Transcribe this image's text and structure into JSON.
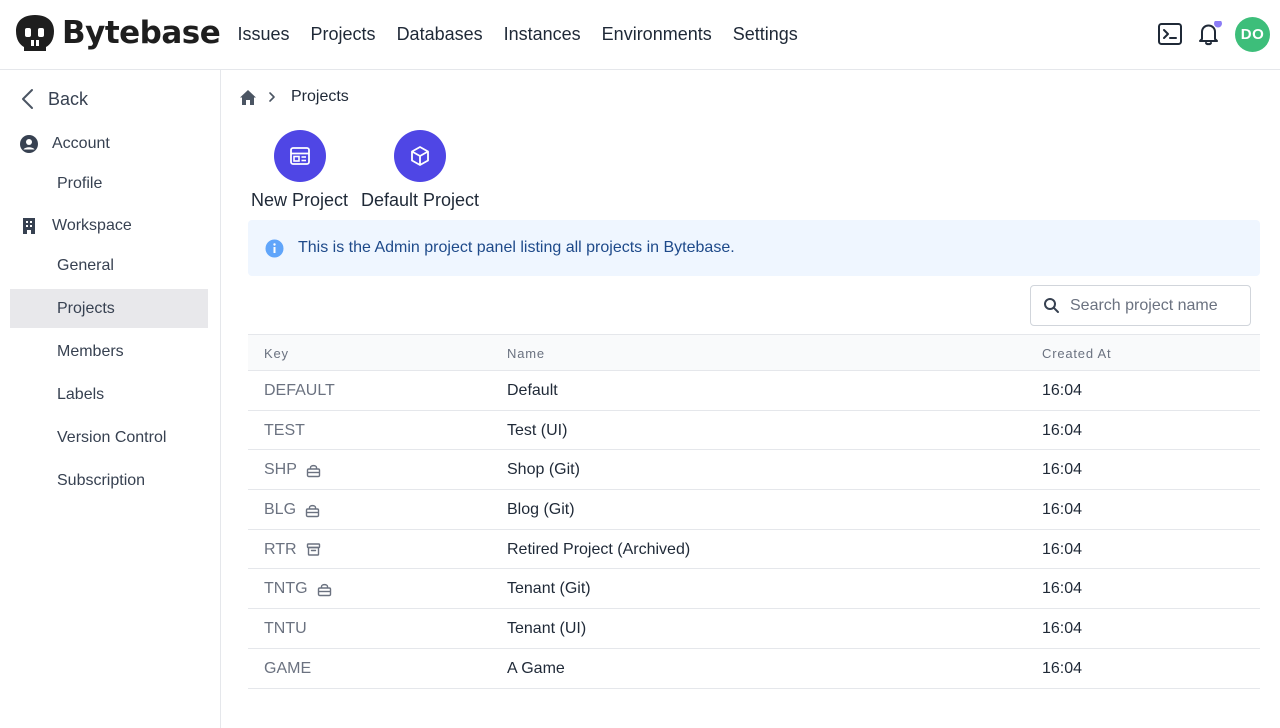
{
  "header": {
    "brand": "Bytebase",
    "nav": [
      "Issues",
      "Projects",
      "Databases",
      "Instances",
      "Environments",
      "Settings"
    ],
    "avatar_initials": "DO",
    "notification_dot_color": "#8b7cf6"
  },
  "sidebar": {
    "back_label": "Back",
    "account_label": "Account",
    "account_items": [
      "Profile"
    ],
    "workspace_label": "Workspace",
    "workspace_items": [
      "General",
      "Projects",
      "Members",
      "Labels",
      "Version Control",
      "Subscription"
    ],
    "active_item": "Projects"
  },
  "breadcrumb": {
    "current": "Projects"
  },
  "quick_actions": [
    {
      "label": "New Project",
      "icon": "new-project-icon"
    },
    {
      "label": "Default Project",
      "icon": "cube-icon"
    }
  ],
  "info_banner": "This is the Admin project panel listing all projects in Bytebase.",
  "search": {
    "placeholder": "Search project name"
  },
  "table": {
    "columns": [
      "Key",
      "Name",
      "Created At"
    ],
    "rows": [
      {
        "key": "DEFAULT",
        "name": "Default",
        "created": "16:04",
        "icon": ""
      },
      {
        "key": "TEST",
        "name": "Test (UI)",
        "created": "16:04",
        "icon": ""
      },
      {
        "key": "SHP",
        "name": "Shop (Git)",
        "created": "16:04",
        "icon": "git-lock-icon"
      },
      {
        "key": "BLG",
        "name": "Blog (Git)",
        "created": "16:04",
        "icon": "git-lock-icon"
      },
      {
        "key": "RTR",
        "name": "Retired Project (Archived)",
        "created": "16:04",
        "icon": "archive-icon"
      },
      {
        "key": "TNTG",
        "name": "Tenant (Git)",
        "created": "16:04",
        "icon": "git-lock-icon"
      },
      {
        "key": "TNTU",
        "name": "Tenant (UI)",
        "created": "16:04",
        "icon": ""
      },
      {
        "key": "GAME",
        "name": "A Game",
        "created": "16:04",
        "icon": ""
      }
    ]
  },
  "colors": {
    "accent": "#4f46e5",
    "avatar": "#3dbe7a",
    "info_bg": "#eff6ff",
    "info_text": "#1e4a8a",
    "active_sidebar": "#e8e8eb"
  }
}
